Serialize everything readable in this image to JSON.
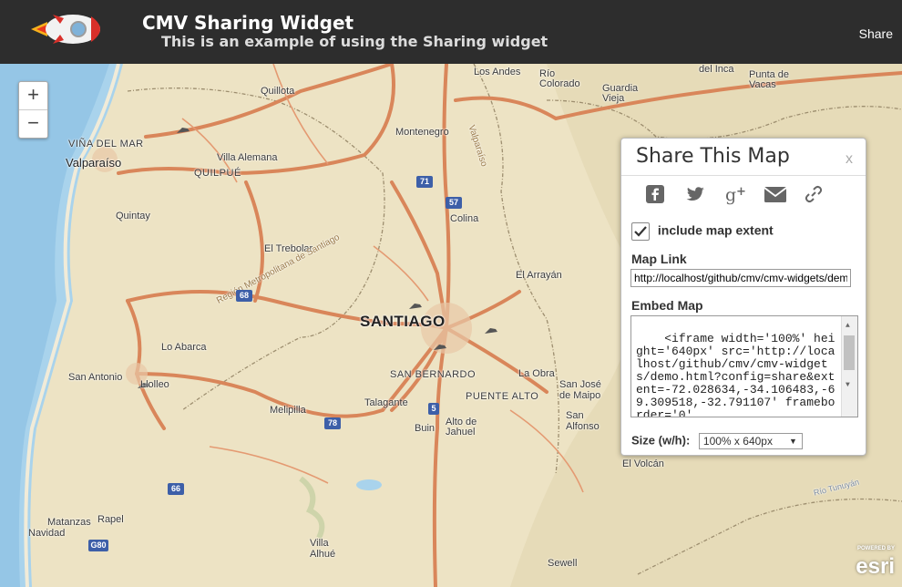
{
  "header": {
    "title": "CMV Sharing Widget",
    "subtitle": "This is an example of using the Sharing widget",
    "share_label": "Share"
  },
  "zoom": {
    "in_label": "+",
    "out_label": "−"
  },
  "map": {
    "labels": {
      "los_andes": "Los Andes",
      "rio_colorado": "Río Colorado",
      "del_inca": "del Inca",
      "punta_vacas": "Punta de Vacas",
      "quillota": "Quillota",
      "guardia_vieja": "Guardia Vieja",
      "vina": "VIÑA DEL MAR",
      "valparaiso": "Valparaíso",
      "montenegro": "Montenegro",
      "villa_alemana": "Villa Alemana",
      "quilpue": "QUILPUÉ",
      "quintay": "Quintay",
      "colina": "Colina",
      "el_trebolar": "El Trebolar",
      "el_arrayan": "El Arrayán",
      "santiago": "SANTIAGO",
      "lo_abarca": "Lo Abarca",
      "san_antonio": "San Antonio",
      "llolleo": "Llolleo",
      "san_bernardo": "SAN BERNARDO",
      "la_obra": "La Obra",
      "san_jose": "San José de Maipo",
      "puente_alto": "PUENTE ALTO",
      "talagante": "Talagante",
      "melipilla": "Melipilla",
      "buin": "Buin",
      "alto_jahuel": "Alto de Jahuel",
      "san_alfonso": "San Alfonso",
      "el_volcan": "El Volcán",
      "matanzas": "Matanzas",
      "navidad": "Navidad",
      "rapel": "Rapel",
      "villa_alhue": "Villa Alhué",
      "sewell": "Sewell",
      "region": "Región Metropolitana de Santiago",
      "valparaiso_region": "Valparaíso",
      "rio_tunuyan": "Río Tunuyán"
    },
    "shields": {
      "r71": "71",
      "r57": "57",
      "r68": "68",
      "r5": "5",
      "r78": "78",
      "r66": "66",
      "g80": "G80"
    },
    "attribution": {
      "powered": "POWERED BY",
      "brand": "esri"
    }
  },
  "share_panel": {
    "title": "Share This Map",
    "close_label": "x",
    "social_icons": [
      "facebook-icon",
      "twitter-icon",
      "google-plus-icon",
      "email-icon",
      "link-icon"
    ],
    "include_extent_label": "include map extent",
    "include_extent_checked": true,
    "map_link_label": "Map Link",
    "map_link_value": "http://localhost/github/cmv/cmv-widgets/demo.html?config=share",
    "embed_label": "Embed Map",
    "embed_code": "<iframe width='100%' height='640px' src='http://localhost/github/cmv/cmv-widgets/demo.html?config=share&extent=-72.028634,-34.106483,-69.309518,-32.791107' frameborder='0'",
    "size_label": "Size (w/h):",
    "size_value": "100% x 640px"
  }
}
